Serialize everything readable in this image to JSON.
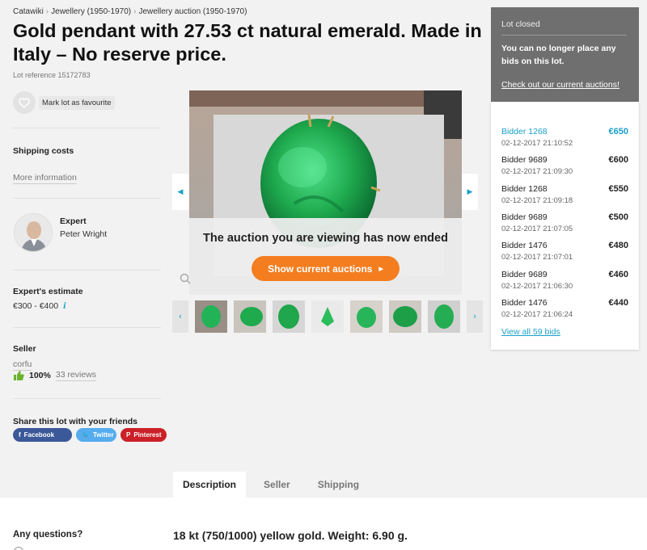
{
  "breadcrumb": [
    "Catawiki",
    "Jewellery (1950-1970)",
    "Jewellery auction (1950-1970)"
  ],
  "title": "Gold pendant with 27.53 ct natural emerald. Made in Italy – No reserve price.",
  "lot_reference": "Lot reference 15172783",
  "favourite_label": "Mark lot as favourite",
  "shipping": {
    "heading": "Shipping costs",
    "more_info": "More information"
  },
  "expert": {
    "heading": "Expert",
    "name": "Peter Wright"
  },
  "estimate": {
    "heading": "Expert's estimate",
    "value": "€300 - €400",
    "info_glyph": "i"
  },
  "seller": {
    "heading": "Seller",
    "name": "corfu",
    "rating": "100%",
    "reviews": "33 reviews"
  },
  "share": {
    "heading": "Share this lot with your friends",
    "buttons": [
      {
        "label": "Facebook",
        "glyph": "f"
      },
      {
        "label": "Twitter",
        "glyph": "🐦"
      },
      {
        "label": "Pinterest",
        "glyph": "P"
      }
    ]
  },
  "gallery": {
    "ended_message": "The auction you are viewing has now ended",
    "show_button": "Show current auctions",
    "prev_glyph": "◀",
    "next_glyph": "▶",
    "thumb_prev_glyph": "‹",
    "thumb_next_glyph": "›"
  },
  "lot_status": {
    "title": "Lot closed",
    "message": "You can no longer place any bids on this lot.",
    "link": "Check out our current auctions!"
  },
  "bids": [
    {
      "bidder": "Bidder 1268",
      "time": "02-12-2017 21:10:52",
      "amount": "€650"
    },
    {
      "bidder": "Bidder 9689",
      "time": "02-12-2017 21:09:30",
      "amount": "€600"
    },
    {
      "bidder": "Bidder 1268",
      "time": "02-12-2017 21:09:18",
      "amount": "€550"
    },
    {
      "bidder": "Bidder 9689",
      "time": "02-12-2017 21:07:05",
      "amount": "€500"
    },
    {
      "bidder": "Bidder 1476",
      "time": "02-12-2017 21:07:01",
      "amount": "€480"
    },
    {
      "bidder": "Bidder 9689",
      "time": "02-12-2017 21:06:30",
      "amount": "€460"
    },
    {
      "bidder": "Bidder 1476",
      "time": "02-12-2017 21:06:24",
      "amount": "€440"
    }
  ],
  "view_all_bids": "View all 59 bids",
  "tabs": [
    "Description",
    "Seller",
    "Shipping"
  ],
  "questions_heading": "Any questions?",
  "description_first_line": "18 kt (750/1000) yellow gold. Weight: 6.90 g.",
  "colors": {
    "accent": "#1aa0c8",
    "cta": "#f47d20",
    "panel": "#6f6f6f",
    "emerald": "#1faa4e"
  }
}
